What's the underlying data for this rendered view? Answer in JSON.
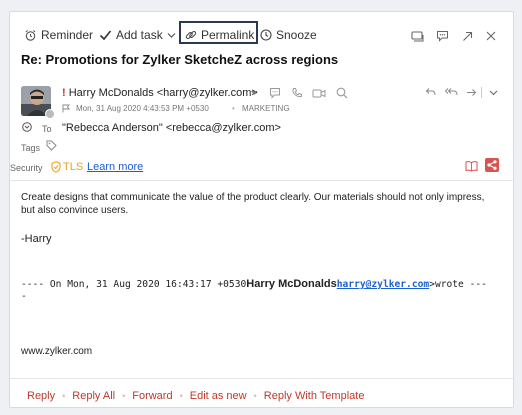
{
  "toolbar": {
    "reminder": "Reminder",
    "add_task": "Add task",
    "permalink": "Permalink",
    "snooze": "Snooze"
  },
  "subject": "Re: Promotions for Zylker SketcheZ across regions",
  "sender": {
    "priority_mark": "!",
    "from": "Harry McDonalds <harry@zylker.com>",
    "date": "Mon, 31 Aug 2020 4:43:53 PM +0530",
    "dot": "•",
    "folder": "MARKETING"
  },
  "to": {
    "label": "To",
    "value": "\"Rebecca Anderson\" <rebecca@zylker.com>"
  },
  "tags": {
    "label": "Tags"
  },
  "security": {
    "label": "Security",
    "tls": "TLS",
    "learn_more": "Learn more"
  },
  "body": {
    "line1": "Create designs that communicate the value of the product clearly. Our materials should not only impress,",
    "line2": "but also convince users.",
    "signature": "-Harry",
    "quote_prefix": "---- On Mon, 31 Aug 2020 16:43:17 +0530",
    "quote_name": "Harry McDonalds",
    "quote_email": "harry@zylker.com",
    "quote_suffix": ">wrote ---",
    "quote_dash": "-",
    "website": "www.zylker.com"
  },
  "footer": {
    "reply": "Reply",
    "reply_all": "Reply All",
    "forward": "Forward",
    "edit_as_new": "Edit as new",
    "reply_template": "Reply With Template",
    "separator": "•"
  },
  "colors": {
    "accent_red": "#c0392b",
    "link_blue": "#1a5fd6",
    "tls_orange": "#f0a020",
    "focus_box": "#2a3a55"
  }
}
